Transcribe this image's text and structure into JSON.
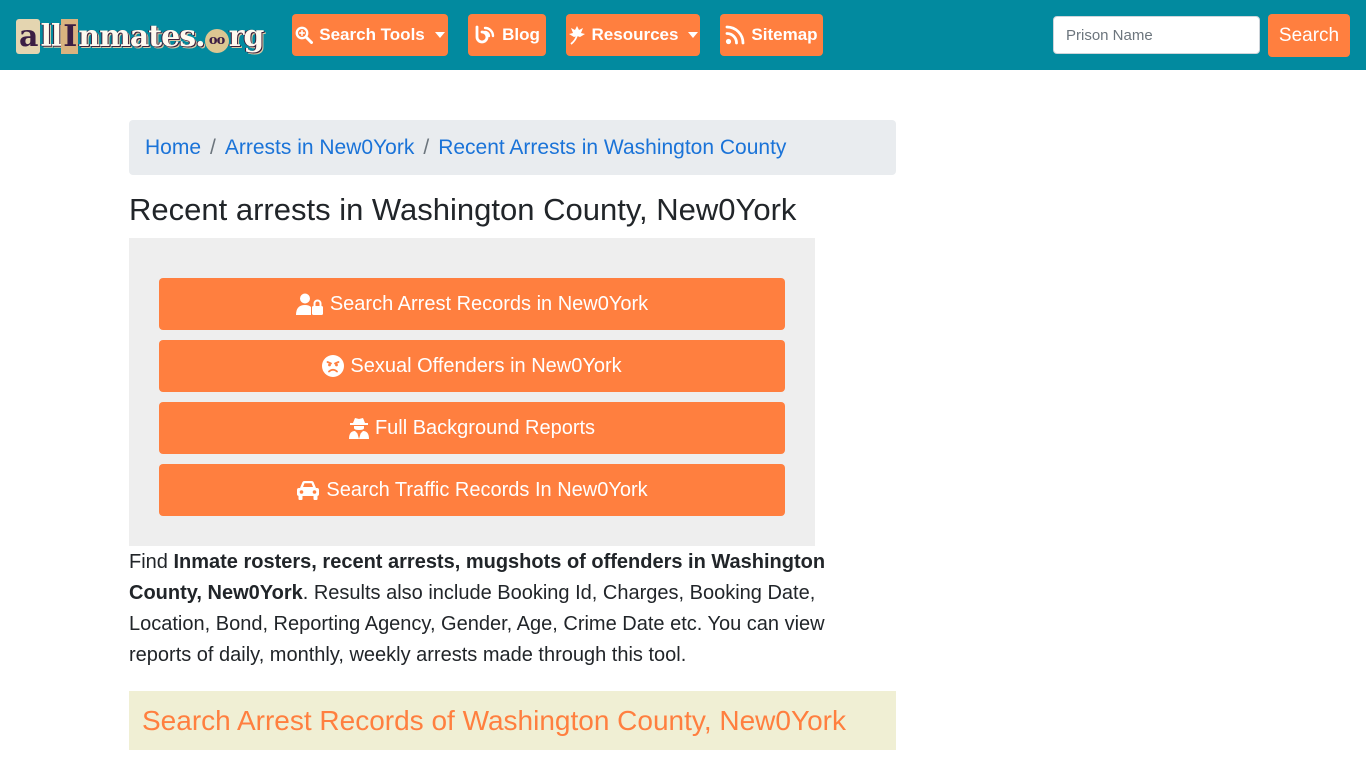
{
  "navbar": {
    "logo": {
      "parts": [
        "a",
        "ll",
        "I",
        "nmates.",
        "oo",
        "rg"
      ],
      "alt": "allInmates.org"
    },
    "items": [
      {
        "label": "Search Tools",
        "icon": "search-plus-icon",
        "has_dropdown": true
      },
      {
        "label": "Blog",
        "icon": "blog-icon",
        "has_dropdown": false
      },
      {
        "label": "Resources",
        "icon": "leaf-icon",
        "has_dropdown": true
      },
      {
        "label": "Sitemap",
        "icon": "rss-icon",
        "has_dropdown": false
      }
    ],
    "search": {
      "placeholder": "Prison Name",
      "value": "",
      "button_label": "Search"
    }
  },
  "breadcrumb": {
    "items": [
      {
        "label": "Home"
      },
      {
        "label": "Arrests in New0York"
      },
      {
        "label": "Recent Arrests in Washington County"
      }
    ],
    "separator": "/"
  },
  "page_title": "Recent arrests in Washington County, New0York",
  "action_buttons": [
    {
      "label": "Search Arrest Records in New0York",
      "icon": "user-lock-icon"
    },
    {
      "label": "Sexual Offenders in New0York",
      "icon": "angry-face-icon"
    },
    {
      "label": "Full Background Reports",
      "icon": "user-secret-icon"
    },
    {
      "label": "Search Traffic Records In New0York",
      "icon": "car-icon"
    }
  ],
  "description": {
    "prefix": "Find ",
    "bold": "Inmate rosters, recent arrests, mugshots of offenders in Washington County, New0York",
    "suffix": ". Results also include Booking Id, Charges, Booking Date, Location, Bond, Reporting Agency, Gender, Age, Crime Date etc. You can view reports of daily, monthly, weekly arrests made through this tool."
  },
  "section_heading": "Search Arrest Records of Washington County, New0York",
  "colors": {
    "navbar_bg": "#028a9f",
    "accent_orange": "#ff7f3f",
    "link_blue": "#1a73d8",
    "breadcrumb_bg": "#e9ecef",
    "panel_bg": "#eeeeee",
    "section_bg": "#f0efd4"
  }
}
